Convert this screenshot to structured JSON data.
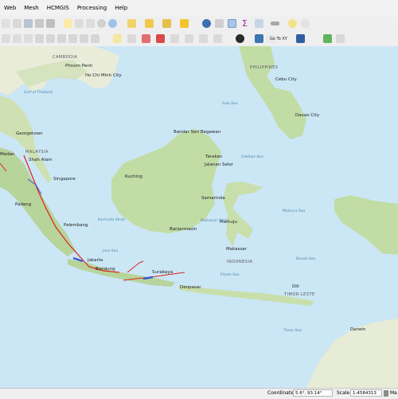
{
  "menu": [
    "Web",
    "Mesh",
    "HCMGIS",
    "Processing",
    "Help"
  ],
  "toolbar": {
    "goto_label": "Go To XY"
  },
  "map": {
    "countries": [
      "CAMBODIA",
      "PHILIPPINES",
      "MALAYSIA",
      "INDONESIA",
      "TIMOR-LESTE"
    ],
    "cities": [
      "Phnom Penh",
      "Ho Chi Minh City",
      "Cebu City",
      "Davao City",
      "Georgetown",
      "Medan",
      "Shah Alam",
      "Singapore",
      "Bandar Seri Begawan",
      "Tarakan",
      "Jalanan Selor",
      "Kuching",
      "Samarinda",
      "Padang",
      "Palembang",
      "Banjarmasin",
      "Mamuju",
      "Makassar",
      "Jakarta",
      "Bandung",
      "Surabaya",
      "Denpasar",
      "Dili",
      "Darwin"
    ],
    "seas": [
      "Gulf of Thailand",
      "Sulu Sea",
      "Celebes Sea",
      "Karimata Strait",
      "Java Sea",
      "Makassar Strait",
      "Flores Sea",
      "Molucca Sea",
      "Banda Sea",
      "Timor Sea"
    ]
  },
  "status": {
    "coord_label": "Coordinate",
    "coord_value": "5.6°, 93.14°",
    "scale_label": "Scale",
    "scale_value": "1:4584313",
    "ma_label": "Ma"
  }
}
